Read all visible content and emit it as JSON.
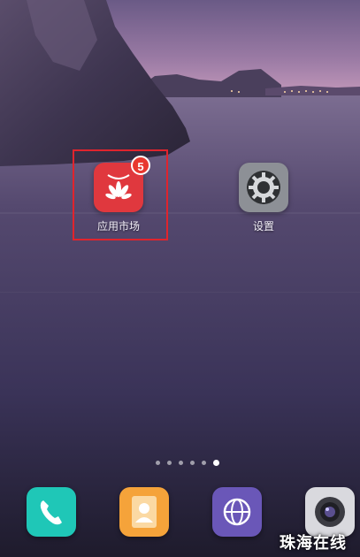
{
  "home_screen": {
    "apps": [
      {
        "label": "应用市场",
        "badge": "5",
        "icon": "huawei-appgallery-icon",
        "color": "#e0383e"
      },
      {
        "label": "设置",
        "icon": "gear-icon",
        "color": "#8d9096"
      }
    ],
    "page_indicator": {
      "pages": 6,
      "current": 6
    }
  },
  "dock": {
    "items": [
      {
        "icon": "phone-icon",
        "color": "#1fc7b7"
      },
      {
        "icon": "contacts-icon",
        "color": "#f5a33a"
      },
      {
        "icon": "browser-icon",
        "color": "#6a57b8"
      },
      {
        "icon": "camera-icon",
        "color": "#d9d9de"
      }
    ]
  },
  "annotation": {
    "highlight_color": "#e0242d"
  },
  "watermark": {
    "text": "珠海在线"
  }
}
